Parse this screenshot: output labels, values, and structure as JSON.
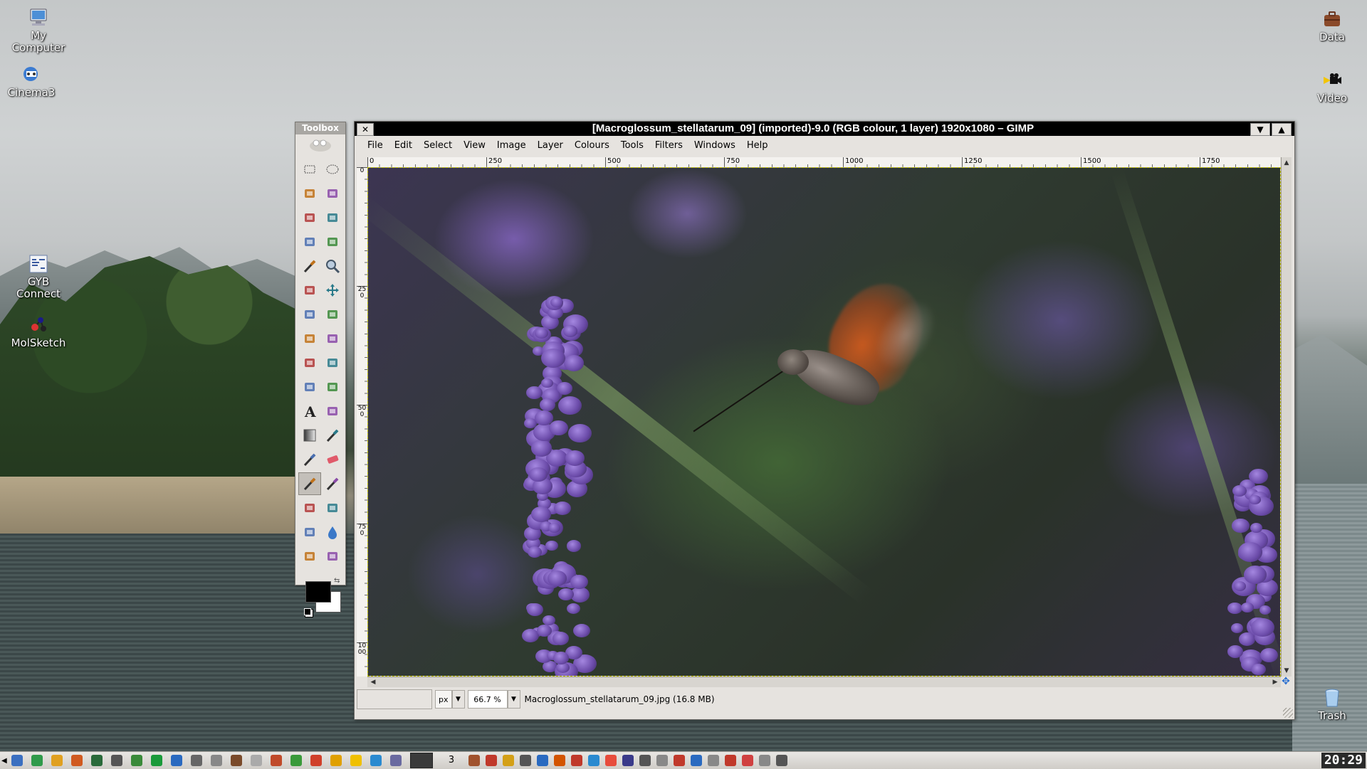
{
  "desktop": {
    "icons_left": [
      {
        "label": "My\nComputer",
        "icon": "computer-icon"
      },
      {
        "label": "Cinema3",
        "icon": "cinema-icon"
      },
      {
        "label": "GYB\nConnect",
        "icon": "gyb-connect-icon"
      },
      {
        "label": "MolSketch",
        "icon": "molsketch-icon"
      }
    ],
    "icons_right": [
      {
        "label": "Data",
        "icon": "briefcase-icon"
      },
      {
        "label": "Video",
        "icon": "video-camera-icon"
      },
      {
        "label": "Trash",
        "icon": "trash-icon"
      }
    ]
  },
  "toolbox": {
    "title": "Toolbox",
    "tools": [
      "rect-select-icon",
      "ellipse-select-icon",
      "free-select-icon",
      "fuzzy-select-icon",
      "select-by-color-icon",
      "scissors-select-icon",
      "foreground-select-icon",
      "paths-icon",
      "color-picker-icon",
      "zoom-icon",
      "measure-icon",
      "move-icon",
      "align-icon",
      "crop-icon",
      "rotate-icon",
      "scale-icon",
      "shear-icon",
      "perspective-icon",
      "flip-icon",
      "cage-transform-icon",
      "text-icon",
      "bucket-fill-icon",
      "blend-icon",
      "pencil-icon",
      "paintbrush-icon",
      "eraser-icon",
      "airbrush-icon",
      "ink-icon",
      "clone-icon",
      "heal-icon",
      "perspective-clone-icon",
      "blur-sharpen-icon",
      "smudge-icon",
      "dodge-burn-icon"
    ],
    "active_tool_index": 26,
    "fg_color": "#000000",
    "bg_color": "#ffffff"
  },
  "window": {
    "title": "[Macroglossum_stellatarum_09] (imported)-9.0 (RGB colour, 1 layer) 1920x1080 – GIMP",
    "close_label": "✕",
    "menu_label": "▼",
    "maximize_label": "▲",
    "menu": [
      "File",
      "Edit",
      "Select",
      "View",
      "Image",
      "Layer",
      "Colours",
      "Tools",
      "Filters",
      "Windows",
      "Help"
    ],
    "ruler_h": [
      "0",
      "250",
      "500",
      "750",
      "1000",
      "1250",
      "1500",
      "1750"
    ],
    "ruler_v": [
      "0",
      "250",
      "500",
      "750",
      "1000"
    ]
  },
  "statusbar": {
    "unit": "px",
    "zoom": "66.7 %",
    "message": "Macroglossum_stellatarum_09.jpg (16.8 MB)"
  },
  "taskbar": {
    "workspace": "3",
    "clock": "20:29"
  },
  "colors": {
    "titlebar": "#000000",
    "window_bg": "#e6e3df",
    "selection_outline": "#c8c800"
  }
}
